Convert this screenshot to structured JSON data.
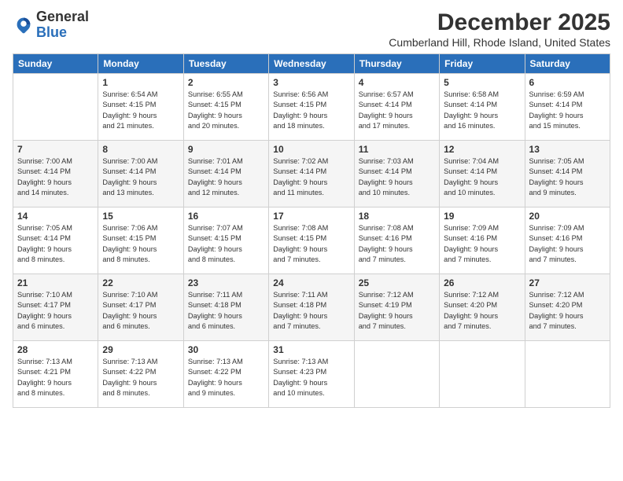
{
  "logo": {
    "general": "General",
    "blue": "Blue"
  },
  "header": {
    "month": "December 2025",
    "location": "Cumberland Hill, Rhode Island, United States"
  },
  "weekdays": [
    "Sunday",
    "Monday",
    "Tuesday",
    "Wednesday",
    "Thursday",
    "Friday",
    "Saturday"
  ],
  "weeks": [
    [
      {
        "day": "",
        "info": ""
      },
      {
        "day": "1",
        "info": "Sunrise: 6:54 AM\nSunset: 4:15 PM\nDaylight: 9 hours\nand 21 minutes."
      },
      {
        "day": "2",
        "info": "Sunrise: 6:55 AM\nSunset: 4:15 PM\nDaylight: 9 hours\nand 20 minutes."
      },
      {
        "day": "3",
        "info": "Sunrise: 6:56 AM\nSunset: 4:15 PM\nDaylight: 9 hours\nand 18 minutes."
      },
      {
        "day": "4",
        "info": "Sunrise: 6:57 AM\nSunset: 4:14 PM\nDaylight: 9 hours\nand 17 minutes."
      },
      {
        "day": "5",
        "info": "Sunrise: 6:58 AM\nSunset: 4:14 PM\nDaylight: 9 hours\nand 16 minutes."
      },
      {
        "day": "6",
        "info": "Sunrise: 6:59 AM\nSunset: 4:14 PM\nDaylight: 9 hours\nand 15 minutes."
      }
    ],
    [
      {
        "day": "7",
        "info": "Sunrise: 7:00 AM\nSunset: 4:14 PM\nDaylight: 9 hours\nand 14 minutes."
      },
      {
        "day": "8",
        "info": "Sunrise: 7:00 AM\nSunset: 4:14 PM\nDaylight: 9 hours\nand 13 minutes."
      },
      {
        "day": "9",
        "info": "Sunrise: 7:01 AM\nSunset: 4:14 PM\nDaylight: 9 hours\nand 12 minutes."
      },
      {
        "day": "10",
        "info": "Sunrise: 7:02 AM\nSunset: 4:14 PM\nDaylight: 9 hours\nand 11 minutes."
      },
      {
        "day": "11",
        "info": "Sunrise: 7:03 AM\nSunset: 4:14 PM\nDaylight: 9 hours\nand 10 minutes."
      },
      {
        "day": "12",
        "info": "Sunrise: 7:04 AM\nSunset: 4:14 PM\nDaylight: 9 hours\nand 10 minutes."
      },
      {
        "day": "13",
        "info": "Sunrise: 7:05 AM\nSunset: 4:14 PM\nDaylight: 9 hours\nand 9 minutes."
      }
    ],
    [
      {
        "day": "14",
        "info": "Sunrise: 7:05 AM\nSunset: 4:14 PM\nDaylight: 9 hours\nand 8 minutes."
      },
      {
        "day": "15",
        "info": "Sunrise: 7:06 AM\nSunset: 4:15 PM\nDaylight: 9 hours\nand 8 minutes."
      },
      {
        "day": "16",
        "info": "Sunrise: 7:07 AM\nSunset: 4:15 PM\nDaylight: 9 hours\nand 8 minutes."
      },
      {
        "day": "17",
        "info": "Sunrise: 7:08 AM\nSunset: 4:15 PM\nDaylight: 9 hours\nand 7 minutes."
      },
      {
        "day": "18",
        "info": "Sunrise: 7:08 AM\nSunset: 4:16 PM\nDaylight: 9 hours\nand 7 minutes."
      },
      {
        "day": "19",
        "info": "Sunrise: 7:09 AM\nSunset: 4:16 PM\nDaylight: 9 hours\nand 7 minutes."
      },
      {
        "day": "20",
        "info": "Sunrise: 7:09 AM\nSunset: 4:16 PM\nDaylight: 9 hours\nand 7 minutes."
      }
    ],
    [
      {
        "day": "21",
        "info": "Sunrise: 7:10 AM\nSunset: 4:17 PM\nDaylight: 9 hours\nand 6 minutes."
      },
      {
        "day": "22",
        "info": "Sunrise: 7:10 AM\nSunset: 4:17 PM\nDaylight: 9 hours\nand 6 minutes."
      },
      {
        "day": "23",
        "info": "Sunrise: 7:11 AM\nSunset: 4:18 PM\nDaylight: 9 hours\nand 6 minutes."
      },
      {
        "day": "24",
        "info": "Sunrise: 7:11 AM\nSunset: 4:18 PM\nDaylight: 9 hours\nand 7 minutes."
      },
      {
        "day": "25",
        "info": "Sunrise: 7:12 AM\nSunset: 4:19 PM\nDaylight: 9 hours\nand 7 minutes."
      },
      {
        "day": "26",
        "info": "Sunrise: 7:12 AM\nSunset: 4:20 PM\nDaylight: 9 hours\nand 7 minutes."
      },
      {
        "day": "27",
        "info": "Sunrise: 7:12 AM\nSunset: 4:20 PM\nDaylight: 9 hours\nand 7 minutes."
      }
    ],
    [
      {
        "day": "28",
        "info": "Sunrise: 7:13 AM\nSunset: 4:21 PM\nDaylight: 9 hours\nand 8 minutes."
      },
      {
        "day": "29",
        "info": "Sunrise: 7:13 AM\nSunset: 4:22 PM\nDaylight: 9 hours\nand 8 minutes."
      },
      {
        "day": "30",
        "info": "Sunrise: 7:13 AM\nSunset: 4:22 PM\nDaylight: 9 hours\nand 9 minutes."
      },
      {
        "day": "31",
        "info": "Sunrise: 7:13 AM\nSunset: 4:23 PM\nDaylight: 9 hours\nand 10 minutes."
      },
      {
        "day": "",
        "info": ""
      },
      {
        "day": "",
        "info": ""
      },
      {
        "day": "",
        "info": ""
      }
    ]
  ]
}
